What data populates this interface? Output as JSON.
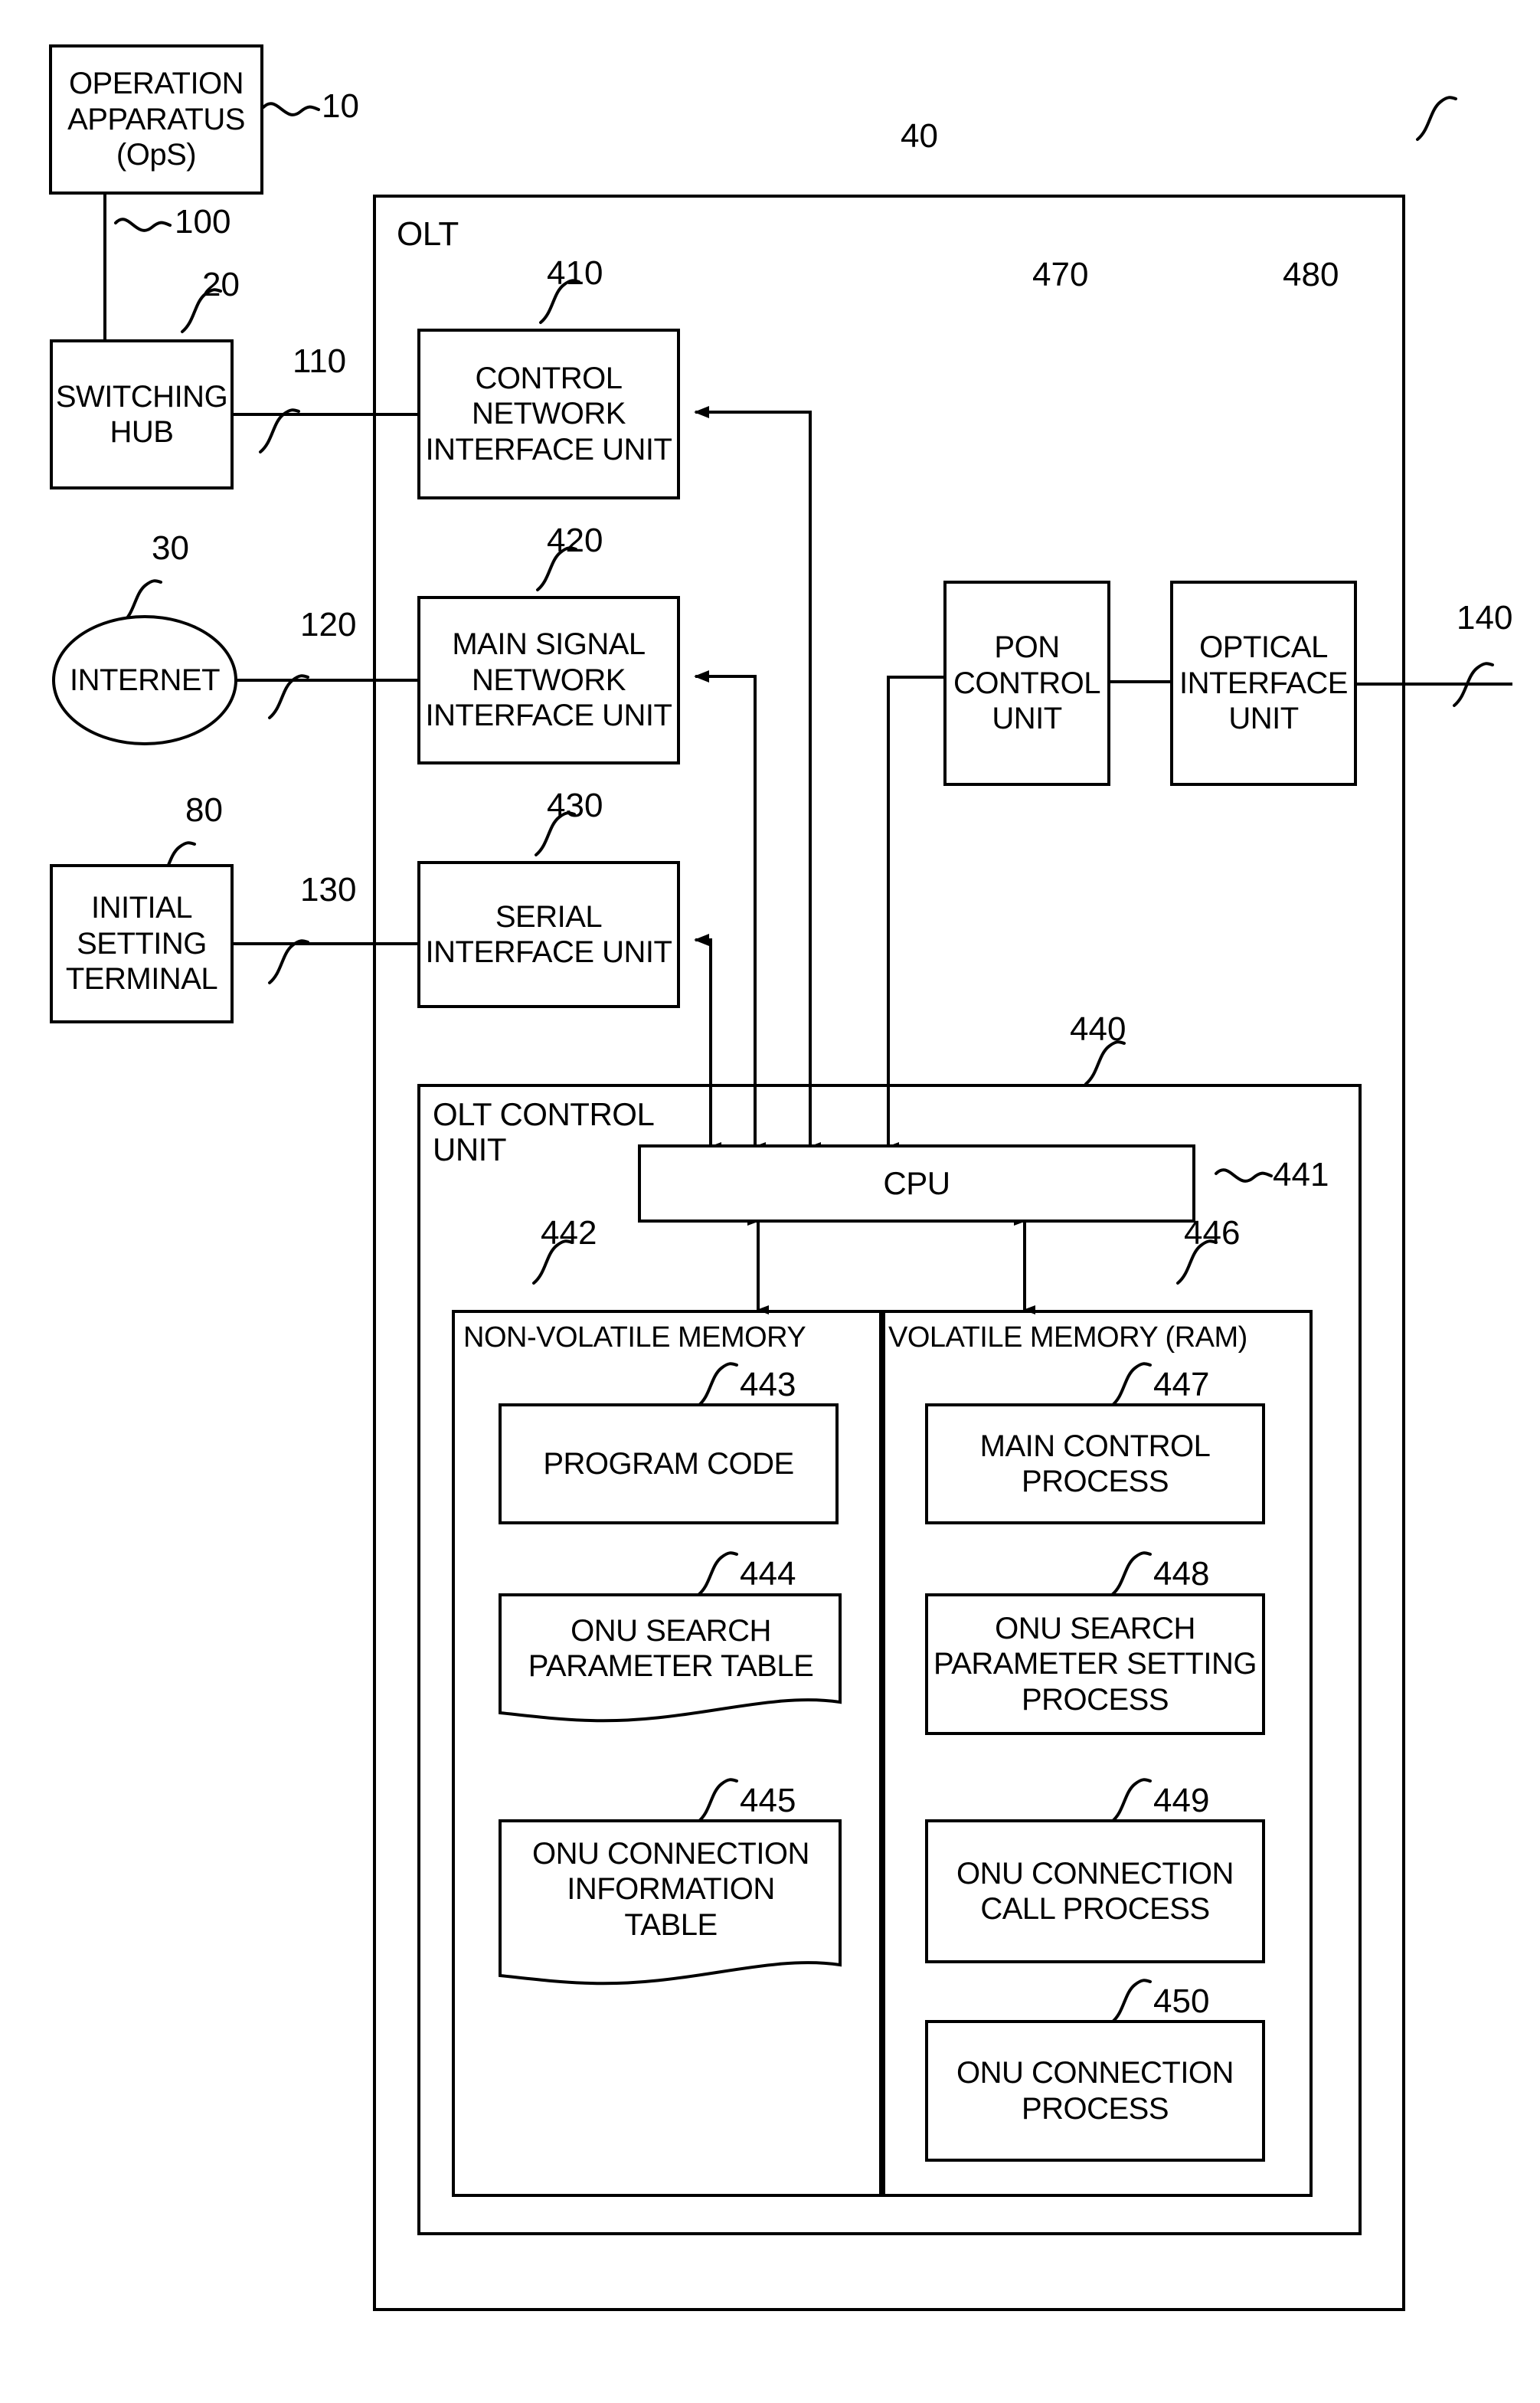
{
  "figure": {
    "type": "patent-block-diagram",
    "outer_system_label": "OLT",
    "outer_system_ref": "40"
  },
  "external_nodes": [
    {
      "name": "operation-apparatus",
      "label": "OPERATION\nAPPARATUS\n(OpS)",
      "ref": "10"
    },
    {
      "name": "switching-hub",
      "label": "SWITCHING\nHUB",
      "ref": "20"
    },
    {
      "name": "internet",
      "label": "INTERNET",
      "ref": "30"
    },
    {
      "name": "initial-setting-terminal",
      "label": "INITIAL\nSETTING\nTERMINAL",
      "ref": "80"
    }
  ],
  "links": [
    {
      "name": "link-ops-hub",
      "ref": "100"
    },
    {
      "name": "link-hub-control-nw",
      "ref": "110"
    },
    {
      "name": "link-internet-main-signal",
      "ref": "120"
    },
    {
      "name": "link-terminal-serial",
      "ref": "130"
    },
    {
      "name": "link-optical-pon",
      "ref": "140"
    }
  ],
  "olt_units": [
    {
      "name": "control-network-interface-unit",
      "label": "CONTROL\nNETWORK\nINTERFACE UNIT",
      "ref": "410"
    },
    {
      "name": "main-signal-network-interface-unit",
      "label": "MAIN SIGNAL\nNETWORK\nINTERFACE UNIT",
      "ref": "420"
    },
    {
      "name": "serial-interface-unit",
      "label": "SERIAL\nINTERFACE UNIT",
      "ref": "430"
    },
    {
      "name": "pon-control-unit",
      "label": "PON\nCONTROL\nUNIT",
      "ref": "470"
    },
    {
      "name": "optical-interface-unit",
      "label": "OPTICAL\nINTERFACE\nUNIT",
      "ref": "480"
    }
  ],
  "olt_control_unit": {
    "label": "OLT CONTROL\nUNIT",
    "ref": "440",
    "cpu": {
      "label": "CPU",
      "ref": "441"
    },
    "non_volatile_memory": {
      "label": "NON-VOLATILE MEMORY",
      "ref": "442",
      "items": [
        {
          "name": "program-code",
          "label": "PROGRAM CODE",
          "ref": "443",
          "shape": "rect"
        },
        {
          "name": "onu-search-parameter-table",
          "label": "ONU SEARCH\nPARAMETER TABLE",
          "ref": "444",
          "shape": "sheet"
        },
        {
          "name": "onu-connection-information-table",
          "label": "ONU CONNECTION\nINFORMATION\nTABLE",
          "ref": "445",
          "shape": "sheet"
        }
      ]
    },
    "volatile_memory": {
      "label": "VOLATILE MEMORY (RAM)",
      "ref": "446",
      "items": [
        {
          "name": "main-control-process",
          "label": "MAIN CONTROL\nPROCESS",
          "ref": "447",
          "shape": "rect"
        },
        {
          "name": "onu-search-parameter-setting-process",
          "label": "ONU SEARCH\nPARAMETER SETTING\nPROCESS",
          "ref": "448",
          "shape": "rect"
        },
        {
          "name": "onu-connection-call-process",
          "label": "ONU CONNECTION\nCALL PROCESS",
          "ref": "449",
          "shape": "rect"
        },
        {
          "name": "onu-connection-process",
          "label": "ONU CONNECTION\nPROCESS",
          "ref": "450",
          "shape": "rect"
        }
      ]
    }
  },
  "colors": {
    "ink": "#000000",
    "paper": "#ffffff"
  }
}
